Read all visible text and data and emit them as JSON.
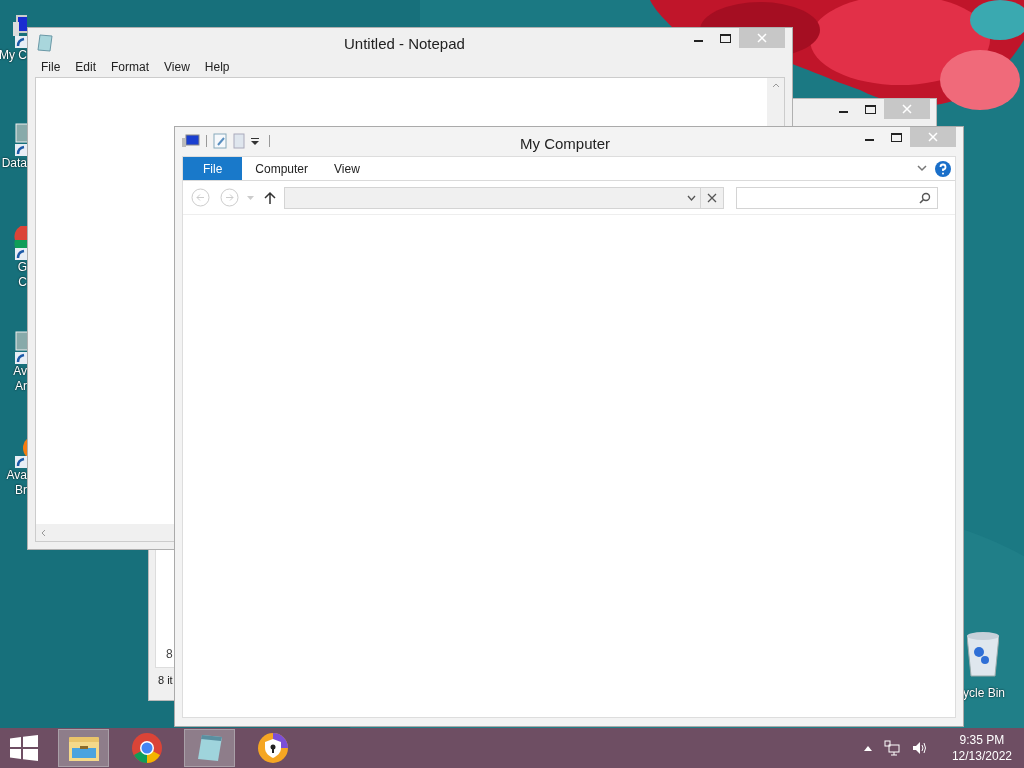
{
  "desktop_icons": [
    {
      "kind": "computer",
      "lines": [
        "My C"
      ]
    },
    {
      "kind": "shortcut",
      "lines": [
        "Data"
      ]
    },
    {
      "kind": "chrome",
      "lines": [
        "G",
        "C"
      ]
    },
    {
      "kind": "shortcut",
      "lines": [
        "Av",
        "Ar"
      ]
    },
    {
      "kind": "orange",
      "lines": [
        "Ava",
        "Br"
      ]
    }
  ],
  "recycle_bin": {
    "label": "ycle Bin"
  },
  "background_window": {
    "cell": "8",
    "status": "8 it"
  },
  "notepad": {
    "title": "Untitled - Notepad",
    "menu": [
      "File",
      "Edit",
      "Format",
      "View",
      "Help"
    ]
  },
  "explorer": {
    "title": "My Computer",
    "tabs": [
      {
        "label": "File",
        "selected": true
      },
      {
        "label": "Computer",
        "selected": false
      },
      {
        "label": "View",
        "selected": false
      }
    ]
  },
  "taskbar": {
    "apps": [
      {
        "kind": "explorer",
        "running": true
      },
      {
        "kind": "chrome",
        "running": false
      },
      {
        "kind": "notepad",
        "running": true
      },
      {
        "kind": "shield",
        "running": false
      }
    ],
    "time": "9:35 PM",
    "date": "12/13/2022"
  }
}
